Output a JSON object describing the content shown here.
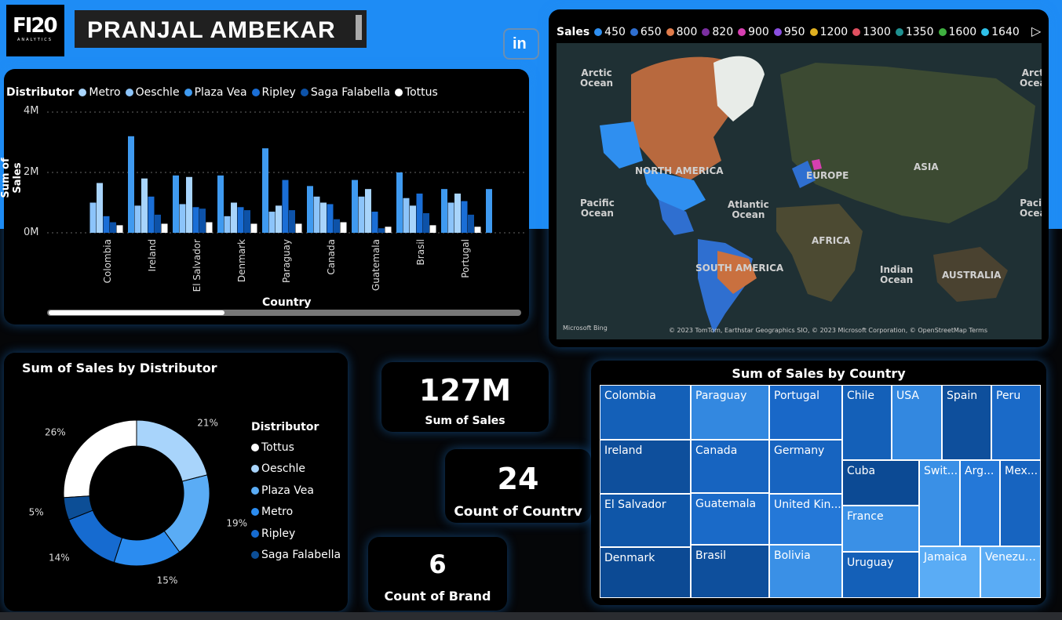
{
  "header": {
    "logo_text": "FI20",
    "logo_sub": "ANALYTICS",
    "name": "PRANJAL  AMBEKAR",
    "linkedin_label": "in"
  },
  "bar_chart": {
    "legend_title": "Distributor",
    "legend": [
      {
        "name": "Metro",
        "color": "#a8d4fb"
      },
      {
        "name": "Oeschle",
        "color": "#8cc4fa"
      },
      {
        "name": "Plaza Vea",
        "color": "#3f9af0"
      },
      {
        "name": "Ripley",
        "color": "#1a6ed6"
      },
      {
        "name": "Saga Falabella",
        "color": "#0d52a8"
      },
      {
        "name": "Tottus",
        "color": "#ffffff"
      }
    ],
    "yticks": [
      "4M",
      "2M",
      "0M"
    ],
    "ylabel": "Sum of Sales",
    "xlabel": "Country",
    "countries": [
      "Colombia",
      "Ireland",
      "El Salvador",
      "Denmark",
      "Paraguay",
      "Canada",
      "Guatemala",
      "Brasil",
      "Portugal"
    ]
  },
  "chart_data": {
    "type": "bar",
    "ylim": [
      0,
      4
    ],
    "series_order": [
      "Plaza Vea",
      "Oeschle",
      "Metro",
      "Ripley",
      "Saga Falabella",
      "Tottus"
    ],
    "groups": [
      [
        0.0,
        1.0,
        1.65,
        0.55,
        0.35,
        0.25
      ],
      [
        3.2,
        0.9,
        1.8,
        1.2,
        0.6,
        0.3
      ],
      [
        1.9,
        0.95,
        1.85,
        0.85,
        0.8,
        0.35
      ],
      [
        1.9,
        0.55,
        1.0,
        0.85,
        0.75,
        0.3
      ],
      [
        2.8,
        0.7,
        0.9,
        1.75,
        0.75,
        0.3
      ],
      [
        1.55,
        1.2,
        1.0,
        0.95,
        0.45,
        0.35
      ],
      [
        1.75,
        1.2,
        1.45,
        0.7,
        0.15,
        0.2
      ],
      [
        2.0,
        1.15,
        0.9,
        1.3,
        0.65,
        0.25
      ],
      [
        1.45,
        1.0,
        1.3,
        1.05,
        0.6,
        0.2
      ],
      [
        1.45,
        0,
        0,
        0,
        0,
        0
      ]
    ]
  },
  "map": {
    "legend_title": "Sales",
    "legend": [
      {
        "label": "450",
        "color": "#2f8ff0"
      },
      {
        "label": "650",
        "color": "#2f6fd0"
      },
      {
        "label": "800",
        "color": "#e07b4a"
      },
      {
        "label": "820",
        "color": "#7b2fa0"
      },
      {
        "label": "900",
        "color": "#d63fb0"
      },
      {
        "label": "950",
        "color": "#8a4fe0"
      },
      {
        "label": "1200",
        "color": "#e0b020"
      },
      {
        "label": "1300",
        "color": "#e04f5f"
      },
      {
        "label": "1350",
        "color": "#1f9090"
      },
      {
        "label": "1600",
        "color": "#3fb040"
      },
      {
        "label": "1640",
        "color": "#2fc0e8"
      }
    ],
    "labels": {
      "arctic1": "Arctic\nOcean",
      "arctic2": "Arct\nOcea",
      "north_america": "NORTH AMERICA",
      "europe": "EUROPE",
      "asia": "ASIA",
      "pacific1": "Pacific\nOcean",
      "pacific2": "Pacif\nOcea",
      "atlantic": "Atlantic\nOcean",
      "africa": "AFRICA",
      "south_america": "SOUTH AMERICA",
      "indian": "Indian\nOcean",
      "australia": "AUSTRALIA"
    },
    "credit_left": "Microsoft Bing",
    "credit_right": "© 2023 TomTom, Earthstar Geographics SIO, © 2023 Microsoft Corporation, © OpenStreetMap  Terms"
  },
  "donut": {
    "title": "Sum of Sales by Distributor",
    "legend_title": "Distributor",
    "slices": [
      {
        "name": "Tottus",
        "pct": 26,
        "label": "26%",
        "color": "#ffffff"
      },
      {
        "name": "Oeschle",
        "pct": 21,
        "label": "21%",
        "color": "#a8d4fb"
      },
      {
        "name": "Plaza Vea",
        "pct": 19,
        "label": "19%",
        "color": "#5aacf5"
      },
      {
        "name": "Metro",
        "pct": 15,
        "label": "15%",
        "color": "#2b8cf0"
      },
      {
        "name": "Ripley",
        "pct": 14,
        "label": "14%",
        "color": "#166bd0"
      },
      {
        "name": "Saga Falabella",
        "pct": 5,
        "label": "5%",
        "color": "#0c4e96"
      }
    ]
  },
  "kpis": {
    "sales_value": "127M",
    "sales_label": "Sum of Sales",
    "country_value": "24",
    "country_label": "Count of Countrv",
    "brand_value": "6",
    "brand_label": "Count of Brand"
  },
  "treemap": {
    "title": "Sum of Sales by Country",
    "cells": [
      {
        "label": "Colombia",
        "color": "#1460b8"
      },
      {
        "label": "Ireland",
        "color": "#0e4f9c"
      },
      {
        "label": "El Salvador",
        "color": "#0f56a8"
      },
      {
        "label": "Denmark",
        "color": "#0c4a94"
      },
      {
        "label": "Paraguay",
        "color": "#3388e0"
      },
      {
        "label": "Canada",
        "color": "#1764c0"
      },
      {
        "label": "Guatemala",
        "color": "#1a6ac8"
      },
      {
        "label": "Brasil",
        "color": "#0e4f9c"
      },
      {
        "label": "Portugal",
        "color": "#1968c8"
      },
      {
        "label": "Germany",
        "color": "#1764c0"
      },
      {
        "label": "United Kin...",
        "color": "#2478d8"
      },
      {
        "label": "Bolivia",
        "color": "#3a90e6"
      },
      {
        "label": "Chile",
        "color": "#1460b8"
      },
      {
        "label": "USA",
        "color": "#3388e0"
      },
      {
        "label": "Spain",
        "color": "#0e4f9c"
      },
      {
        "label": "Peru",
        "color": "#1a6ac8"
      },
      {
        "label": "Cuba",
        "color": "#0c4a94"
      },
      {
        "label": "Swit...",
        "color": "#3a90e6"
      },
      {
        "label": "Arg...",
        "color": "#2478d8"
      },
      {
        "label": "Mex...",
        "color": "#1764c0"
      },
      {
        "label": "France",
        "color": "#3a90e6"
      },
      {
        "label": "Uruguay",
        "color": "#1460b8"
      },
      {
        "label": "Jamaica",
        "color": "#5aacf5"
      },
      {
        "label": "Venezue...",
        "color": "#5aacf5"
      }
    ]
  }
}
